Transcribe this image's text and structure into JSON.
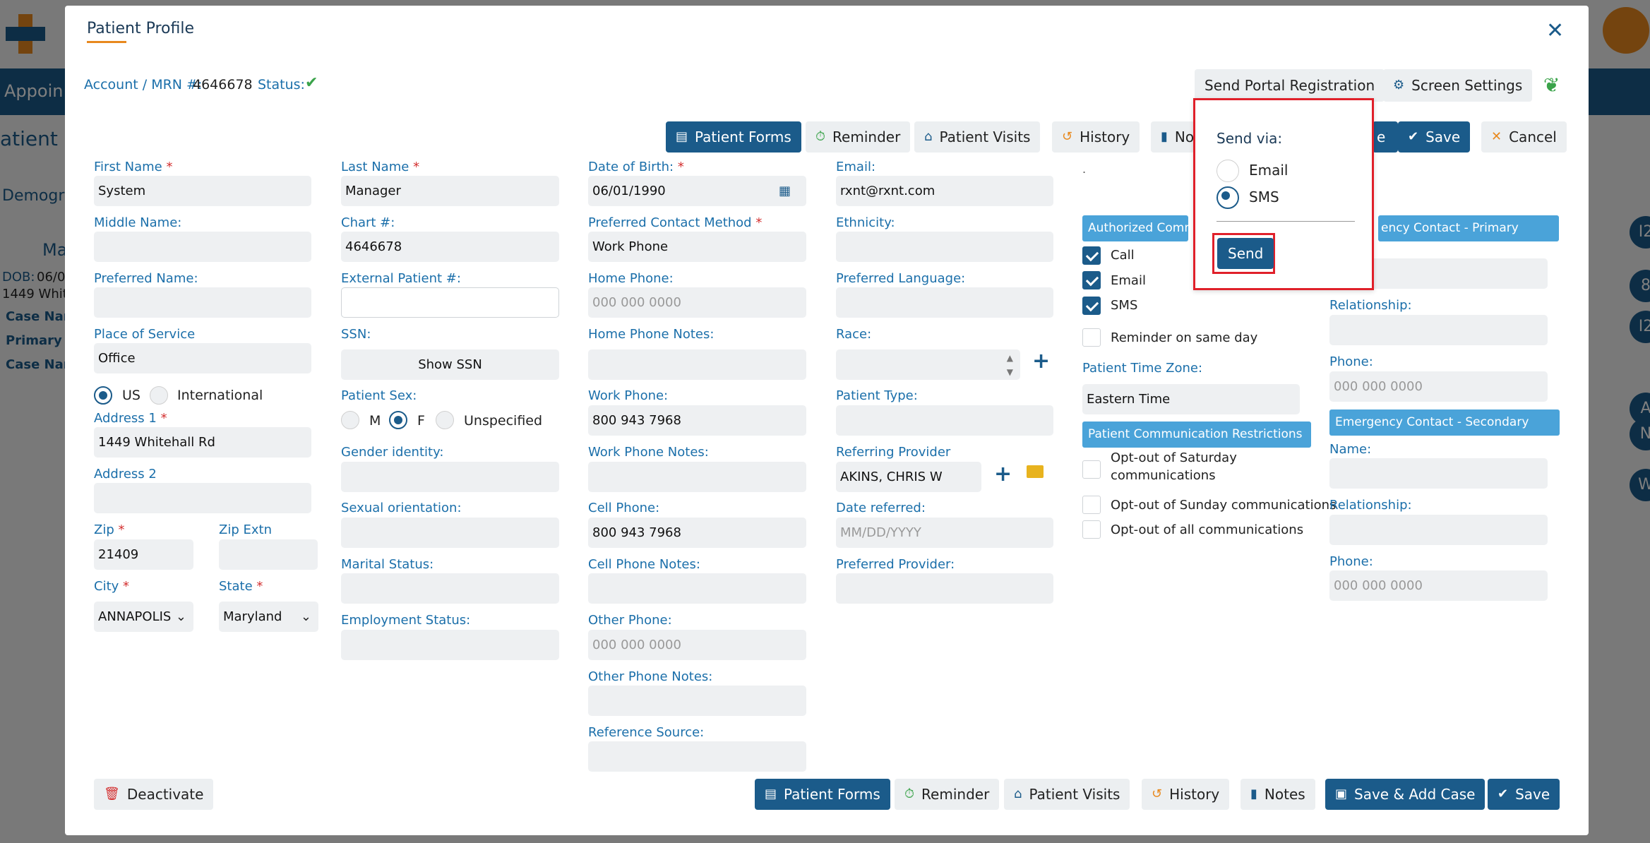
{
  "background": {
    "appointments_label": "Appoin",
    "patient_label": "atient",
    "demographics_tab": "Demogr",
    "patient_name_partial": "Ma",
    "dob_label": "DOB:",
    "dob_partial": "06/0",
    "address_partial": "1449 Whit",
    "case_rows": [
      "Case Nam",
      "Primary",
      "Case Nam"
    ],
    "right_circles": [
      "I2",
      "8",
      "I2",
      "A",
      "N",
      "W"
    ]
  },
  "modal": {
    "title": "Patient Profile",
    "account_label": "Account / MRN #:",
    "account_value": "4646678",
    "status_label": "Status:",
    "send_portal_label": "Send Portal Registration",
    "screen_settings_label": "Screen Settings",
    "toolbar": {
      "patient_forms": "Patient Forms",
      "reminder": "Reminder",
      "patient_visits": "Patient Visits",
      "history": "History",
      "notes_partial": "No",
      "save_case_partial": "e",
      "save": "Save",
      "cancel": "Cancel"
    },
    "col1": {
      "first_name_label": "First Name",
      "first_name_value": "System",
      "middle_name_label": "Middle Name:",
      "preferred_name_label": "Preferred Name:",
      "place_of_service_label": "Place of Service",
      "place_of_service_value": "Office",
      "country_us": "US",
      "country_intl": "International",
      "address1_label": "Address 1",
      "address1_value": "1449 Whitehall Rd",
      "address2_label": "Address 2",
      "zip_label": "Zip",
      "zip_value": "21409",
      "zip_extn_label": "Zip Extn",
      "city_label": "City",
      "city_value": "ANNAPOLIS",
      "state_label": "State",
      "state_value": "Maryland"
    },
    "col2": {
      "last_name_label": "Last Name",
      "last_name_value": "Manager",
      "chart_label": "Chart #:",
      "chart_value": "4646678",
      "external_label": "External Patient #:",
      "ssn_label": "SSN:",
      "show_ssn": "Show SSN",
      "sex_label": "Patient Sex:",
      "sex_m": "M",
      "sex_f": "F",
      "sex_unspecified": "Unspecified",
      "gender_label": "Gender identity:",
      "sexual_label": "Sexual orientation:",
      "marital_label": "Marital Status:",
      "employment_label": "Employment Status:"
    },
    "col3": {
      "dob_label": "Date of Birth:",
      "dob_value": "06/01/1990",
      "contact_method_label": "Preferred Contact Method",
      "contact_method_value": "Work Phone",
      "home_phone_label": "Home Phone:",
      "home_phone_placeholder": "000 000 0000",
      "home_notes_label": "Home Phone Notes:",
      "work_phone_label": "Work Phone:",
      "work_phone_value": "800 943 7968",
      "work_notes_label": "Work Phone Notes:",
      "cell_phone_label": "Cell Phone:",
      "cell_phone_value": "800 943 7968",
      "cell_notes_label": "Cell Phone Notes:",
      "other_phone_label": "Other Phone:",
      "other_phone_placeholder": "000 000 0000",
      "other_notes_label": "Other Phone Notes:",
      "reference_label": "Reference Source:"
    },
    "col4": {
      "email_label": "Email:",
      "email_value": "rxnt@rxnt.com",
      "ethnicity_label": "Ethnicity:",
      "language_label": "Preferred Language:",
      "race_label": "Race:",
      "patient_type_label": "Patient Type:",
      "referring_label": "Referring Provider",
      "referring_value": "AKINS, CHRIS W",
      "date_referred_label": "Date referred:",
      "date_referred_placeholder": "MM/DD/YYYY",
      "preferred_provider_label": "Preferred Provider:"
    },
    "col5": {
      "dot": ".",
      "authorized_header": "Authorized Commu",
      "auth_call": "Call",
      "auth_email": "Email",
      "auth_sms": "SMS",
      "reminder_same_day": "Reminder on same day",
      "timezone_label": "Patient Time Zone:",
      "timezone_value": "Eastern Time",
      "restrictions_header": "Patient Communication Restrictions",
      "opt_sat": "Opt-out of Saturday communications",
      "opt_sun": "Opt-out of Sunday communications",
      "opt_all": "Opt-out of all communications"
    },
    "col6": {
      "primary_header": "ency Contact - Primary",
      "relationship_label": "Relationship:",
      "phone_label": "Phone:",
      "phone_placeholder": "000 000 0000",
      "secondary_header": "Emergency Contact - Secondary",
      "name_label": "Name:",
      "relationship2_label": "Relationship:",
      "phone2_label": "Phone:",
      "phone2_placeholder": "000 000 0000"
    },
    "footer": {
      "deactivate": "Deactivate",
      "patient_forms": "Patient Forms",
      "reminder": "Reminder",
      "patient_visits": "Patient Visits",
      "history": "History",
      "notes": "Notes",
      "save_add_case": "Save & Add Case",
      "save": "Save"
    },
    "popover": {
      "title": "Send via:",
      "option_email": "Email",
      "option_sms": "SMS",
      "send": "Send"
    }
  },
  "colors": {
    "primary": "#1b5b8a",
    "accent_blue": "#4aa3d9",
    "highlight_red": "#e0202a",
    "required_red": "#d32f2f",
    "check_green": "#3aa34a"
  }
}
